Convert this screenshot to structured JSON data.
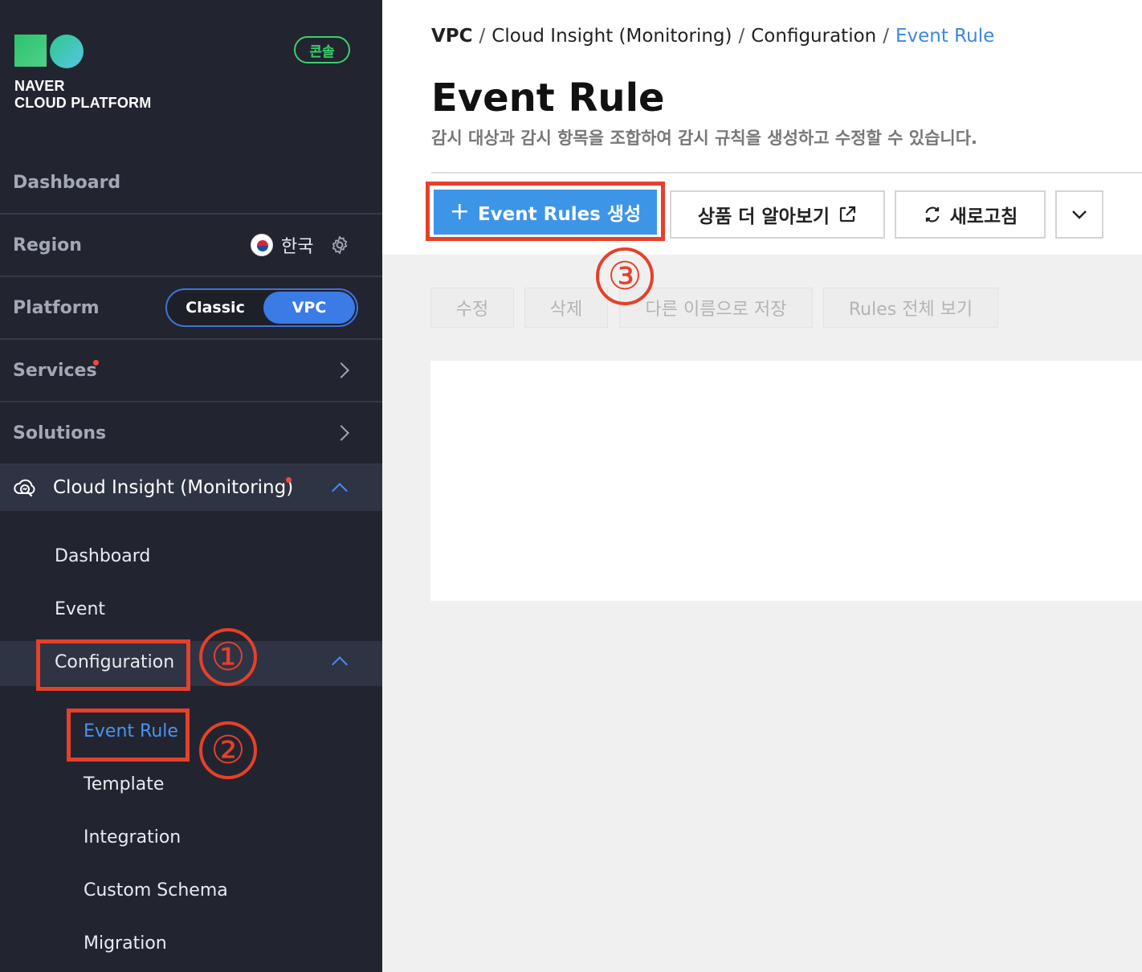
{
  "sidebar": {
    "brand": {
      "line1": "NAVER",
      "line2": "CLOUD PLATFORM"
    },
    "console_badge": "콘솔",
    "dashboard_label": "Dashboard",
    "region": {
      "label": "Region",
      "value": "한국"
    },
    "platform": {
      "label": "Platform",
      "option_classic": "Classic",
      "option_vpc": "VPC",
      "selected": "VPC"
    },
    "services_label": "Services",
    "solutions_label": "Solutions",
    "cloud_insight": {
      "label": "Cloud Insight (Monitoring)",
      "items": {
        "dashboard": "Dashboard",
        "event": "Event",
        "configuration": "Configuration",
        "event_rule": "Event Rule",
        "template": "Template",
        "integration": "Integration",
        "custom_schema": "Custom Schema",
        "migration": "Migration"
      }
    }
  },
  "breadcrumb": {
    "vpc": "VPC",
    "cloud_insight": "Cloud Insight (Monitoring)",
    "configuration": "Configuration",
    "current": "Event Rule",
    "separator": "/"
  },
  "page": {
    "title": "Event Rule",
    "description": "감시 대상과 감시 항목을 조합하여 감시 규칙을 생성하고 수정할 수 있습니다."
  },
  "toolbar": {
    "create_label": "Event Rules 생성",
    "learn_more_label": "상품 더 알아보기",
    "refresh_label": "새로고침"
  },
  "actions": {
    "edit": "수정",
    "delete": "삭제",
    "save_as": "다른 이름으로 저장",
    "view_all": "Rules 전체 보기"
  },
  "annotations": {
    "step1": "①",
    "step2": "②",
    "step3": "③",
    "color": "#e6402b"
  },
  "colors": {
    "sidebar_bg": "#222530",
    "accent_blue": "#3d95e8",
    "console_green": "#3ecf6b"
  }
}
